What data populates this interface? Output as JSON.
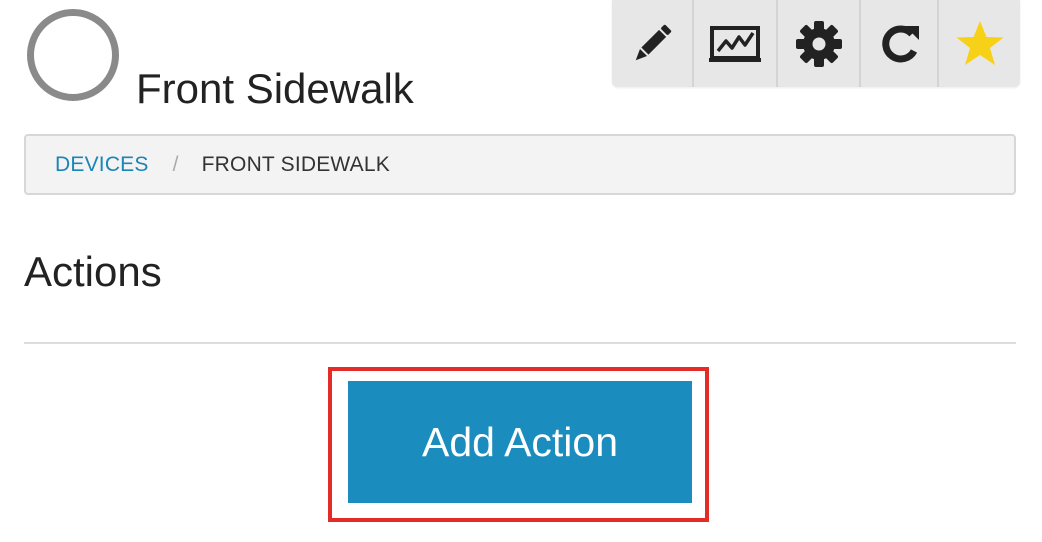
{
  "device": {
    "title": "Front Sidewalk",
    "status_icon": "empty-circle-icon"
  },
  "toolbar": {
    "buttons": [
      {
        "icon": "pencil-icon",
        "action": "edit"
      },
      {
        "icon": "chart-icon",
        "action": "graph"
      },
      {
        "icon": "gear-icon",
        "action": "settings"
      },
      {
        "icon": "refresh-icon",
        "action": "refresh"
      },
      {
        "icon": "star-icon",
        "action": "favorite",
        "color": "#f7d117"
      }
    ]
  },
  "breadcrumb": {
    "parent_label": "DEVICES",
    "separator": "/",
    "current_label": "FRONT SIDEWALK"
  },
  "section": {
    "heading": "Actions"
  },
  "add_action": {
    "label": "Add Action",
    "color": "#1a8cbd",
    "highlight_color": "#e32b27"
  }
}
